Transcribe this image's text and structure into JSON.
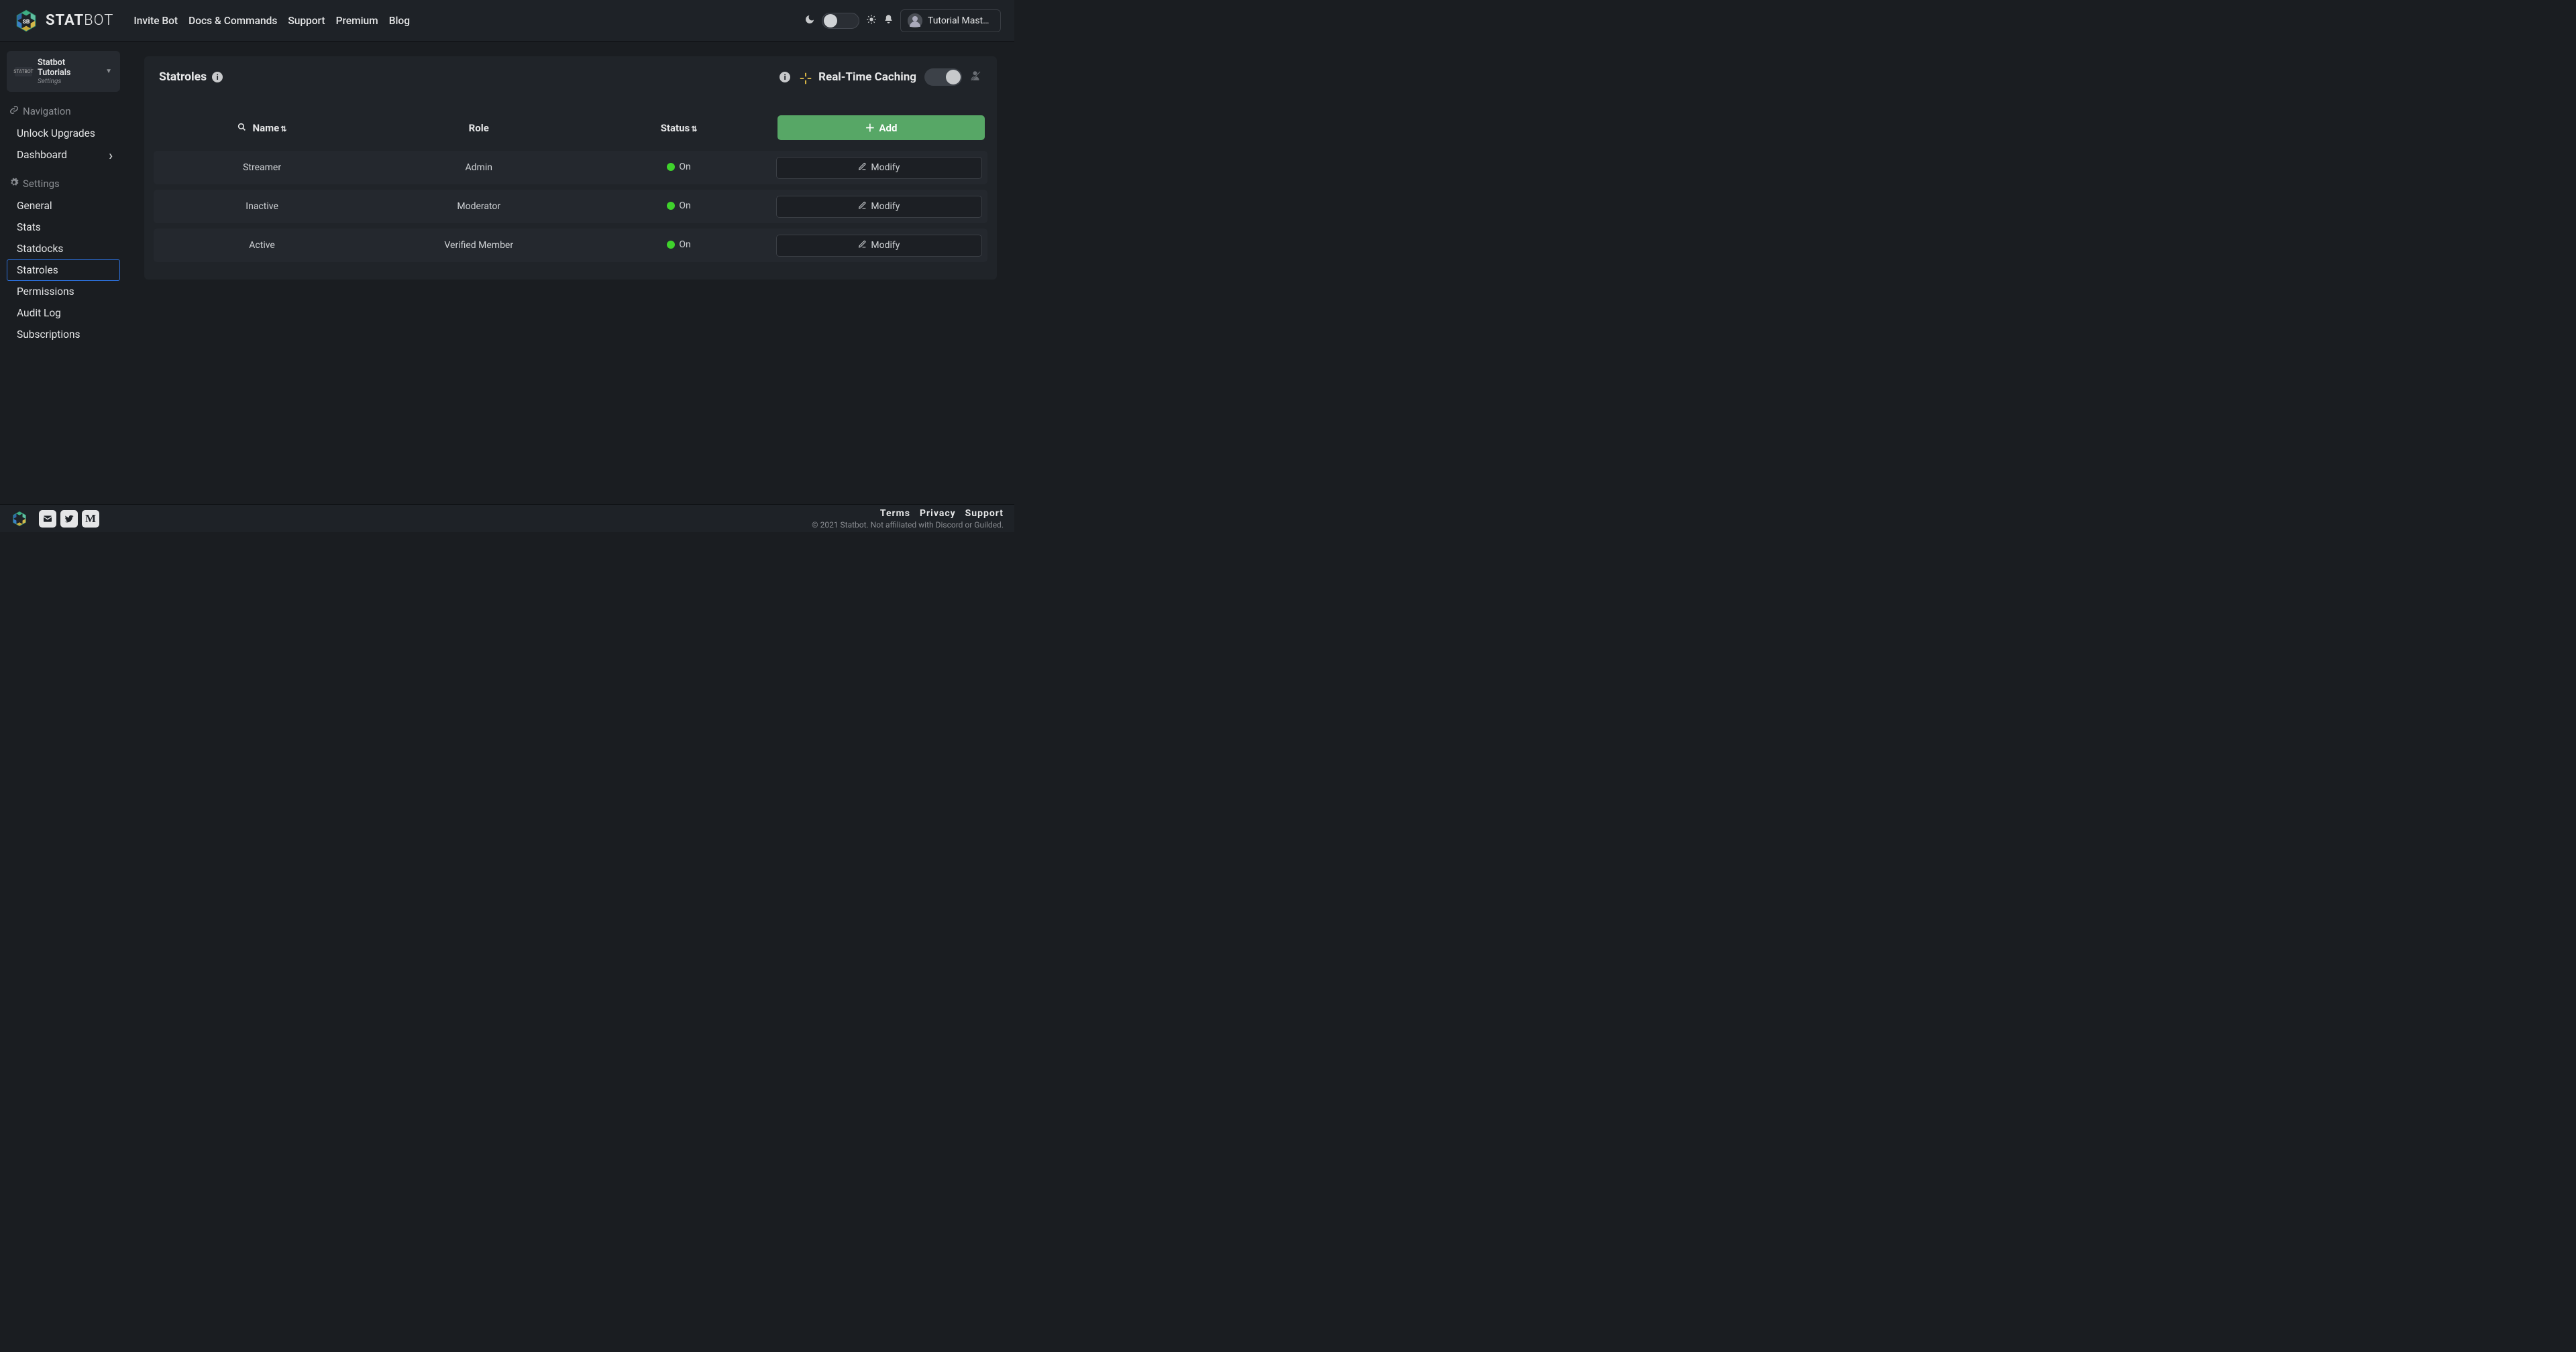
{
  "brand": {
    "name_strong": "STAT",
    "name_light": "BOT"
  },
  "nav": [
    {
      "label": "Invite Bot"
    },
    {
      "label": "Docs & Commands"
    },
    {
      "label": "Support"
    },
    {
      "label": "Premium"
    },
    {
      "label": "Blog"
    }
  ],
  "user": {
    "name": "Tutorial Master#…"
  },
  "sidebar": {
    "server": {
      "name": "Statbot Tutorials",
      "sub": "Settings",
      "badge": "STATBOT"
    },
    "nav_header": "Navigation",
    "nav_items": [
      {
        "label": "Unlock Upgrades",
        "chev": false
      },
      {
        "label": "Dashboard",
        "chev": true
      }
    ],
    "settings_header": "Settings",
    "settings_items": [
      {
        "label": "General",
        "active": false
      },
      {
        "label": "Stats",
        "active": false
      },
      {
        "label": "Statdocks",
        "active": false
      },
      {
        "label": "Statroles",
        "active": true
      },
      {
        "label": "Permissions",
        "active": false
      },
      {
        "label": "Audit Log",
        "active": false
      },
      {
        "label": "Subscriptions",
        "active": false
      }
    ]
  },
  "panel": {
    "title": "Statroles",
    "rtc_label": "Real-Time Caching",
    "columns": {
      "name": "Name",
      "role": "Role",
      "status": "Status"
    },
    "add_label": "Add",
    "modify_label": "Modify",
    "rows": [
      {
        "name": "Streamer",
        "role": "Admin",
        "status": "On"
      },
      {
        "name": "Inactive",
        "role": "Moderator",
        "status": "On"
      },
      {
        "name": "Active",
        "role": "Verified Member",
        "status": "On"
      }
    ]
  },
  "footer": {
    "links": [
      {
        "label": "Terms"
      },
      {
        "label": "Privacy"
      },
      {
        "label": "Support"
      }
    ],
    "copyright": "© 2021 Statbot. Not affiliated with Discord or Guilded."
  }
}
